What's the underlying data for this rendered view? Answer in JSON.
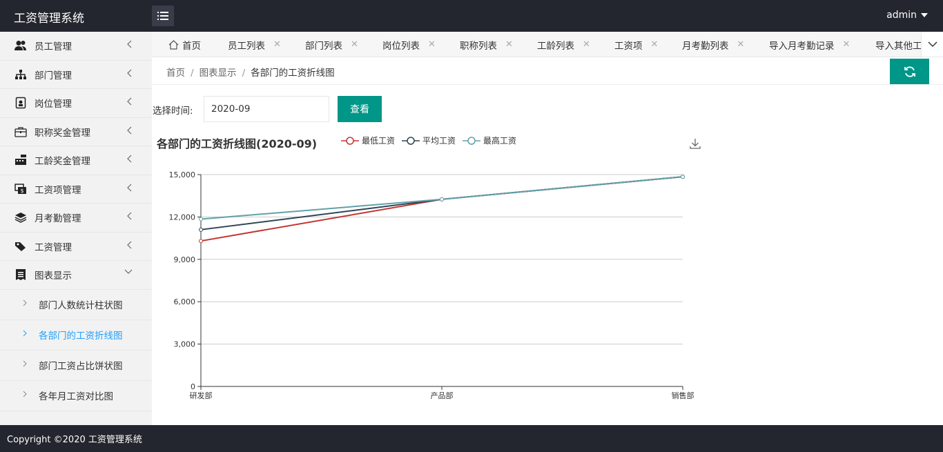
{
  "app": {
    "title": "工资管理系统",
    "user": "admin"
  },
  "sidebar": {
    "items": [
      {
        "label": "员工管理",
        "icon": "users-icon"
      },
      {
        "label": "部门管理",
        "icon": "sitemap-icon"
      },
      {
        "label": "岗位管理",
        "icon": "badge-icon"
      },
      {
        "label": "职称奖金管理",
        "icon": "briefcase-icon"
      },
      {
        "label": "工龄奖金管理",
        "icon": "cash-register-icon"
      },
      {
        "label": "工资项管理",
        "icon": "money-icon"
      },
      {
        "label": "月考勤管理",
        "icon": "layers-icon"
      },
      {
        "label": "工资管理",
        "icon": "tag-icon"
      },
      {
        "label": "图表显示",
        "icon": "receipt-icon"
      }
    ],
    "sub_items": [
      {
        "label": "部门人数统计柱状图"
      },
      {
        "label": "各部门的工资折线图"
      },
      {
        "label": "部门工资占比饼状图"
      },
      {
        "label": "各年月工资对比图"
      }
    ]
  },
  "tabs": [
    {
      "label": "首页"
    },
    {
      "label": "员工列表"
    },
    {
      "label": "部门列表"
    },
    {
      "label": "岗位列表"
    },
    {
      "label": "职称列表"
    },
    {
      "label": "工龄列表"
    },
    {
      "label": "工资项"
    },
    {
      "label": "月考勤列表"
    },
    {
      "label": "导入月考勤记录"
    },
    {
      "label": "导入其他工"
    }
  ],
  "tab_close": "✕",
  "breadcrumb": {
    "home": "首页",
    "section": "图表显示",
    "current": "各部门的工资折线图",
    "sep": "/"
  },
  "filter": {
    "label": "选择时间:",
    "value": "2020-09",
    "button": "查看"
  },
  "footer": {
    "copyright": "Copyright ©2020 工资管理系统"
  },
  "colors": {
    "header": "#23262e",
    "accent": "#009688",
    "active_link": "#1e9fff"
  },
  "chart_data": {
    "type": "line",
    "title": "各部门的工资折线图(2020-09)",
    "categories": [
      "研发部",
      "产品部",
      "销售部"
    ],
    "series": [
      {
        "name": "最低工资",
        "color": "#c23531",
        "values": [
          10300,
          13250,
          14850
        ]
      },
      {
        "name": "平均工资",
        "color": "#2f4554",
        "values": [
          11100,
          13250,
          14850
        ]
      },
      {
        "name": "最高工资",
        "color": "#61a0a8",
        "values": [
          11850,
          13250,
          14850
        ]
      }
    ],
    "ylim": [
      0,
      15000
    ],
    "yticks": [
      0,
      3000,
      6000,
      9000,
      12000,
      15000
    ],
    "ytick_labels": [
      "0",
      "3,000",
      "6,000",
      "9,000",
      "12,000",
      "15,000"
    ],
    "grid": true,
    "legend": "top"
  }
}
